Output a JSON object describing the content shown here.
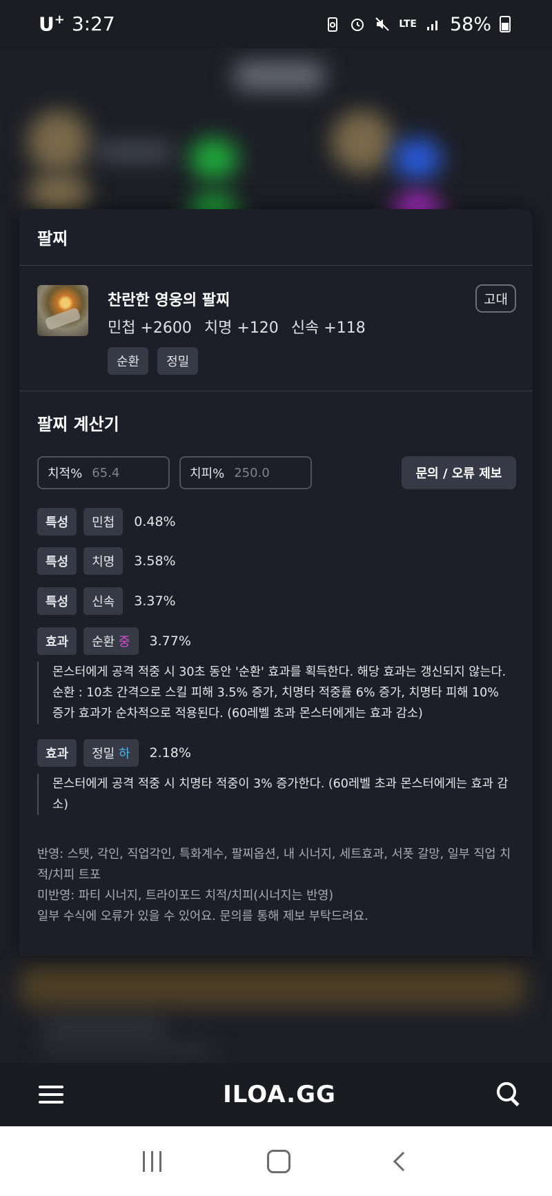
{
  "status_bar": {
    "carrier": "U",
    "carrier_sup": "+",
    "time": "3:27",
    "network": "LTE",
    "battery": "58%"
  },
  "card": {
    "title": "팔찌",
    "item": {
      "name": "찬란한 영웅의 팔찌",
      "grade": "고대",
      "stats": [
        "민첩 +2600",
        "치명 +120",
        "신속 +118"
      ],
      "tags": [
        "순환",
        "정밀"
      ]
    },
    "calculator": {
      "title": "팔찌 계산기",
      "crit_label": "치적%",
      "crit_value": "65.4",
      "critdmg_label": "치피%",
      "critdmg_value": "250.0",
      "report_button": "문의 / 오류 제보",
      "traits": [
        {
          "kind": "특성",
          "name": "민첩",
          "pct": "0.48%"
        },
        {
          "kind": "특성",
          "name": "치명",
          "pct": "3.58%"
        },
        {
          "kind": "특성",
          "name": "신속",
          "pct": "3.37%"
        }
      ],
      "effects": [
        {
          "kind": "효과",
          "name": "순환",
          "tier": "중",
          "pct": "3.77%",
          "desc": "몬스터에게 공격 적중 시 30초 동안 '순환' 효과를 획득한다. 해당 효과는 갱신되지 않는다. 순환 : 10초 간격으로 스킬 피해 3.5% 증가, 치명타 적중률 6% 증가, 치명타 피해 10% 증가 효과가 순차적으로 적용된다. (60레벨 초과 몬스터에게는 효과 감소)"
        },
        {
          "kind": "효과",
          "name": "정밀",
          "tier": "하",
          "pct": "2.18%",
          "desc": "몬스터에게 공격 적중 시 치명타 적중이 3% 증가한다. (60레벨 초과 몬스터에게는 효과 감소)"
        }
      ],
      "notes": [
        "반영: 스탯, 각인, 직업각인, 특화계수, 팔찌옵션, 내 시너지, 세트효과, 서폿 갈망, 일부 직업 치적/치피 트포",
        "미반영: 파티 시너지, 트라이포드 치적/치피(시너지는 반영)",
        "일부 수식에 오류가 있을 수 있어요. 문의를 통해 제보 부탁드려요."
      ]
    }
  },
  "bottom_nav": {
    "logo": "ILOA.GG"
  },
  "colors": {
    "tier_mid": "#d855d6",
    "tier_low": "#4fb3ea",
    "card_bg": "#1c1f27"
  }
}
